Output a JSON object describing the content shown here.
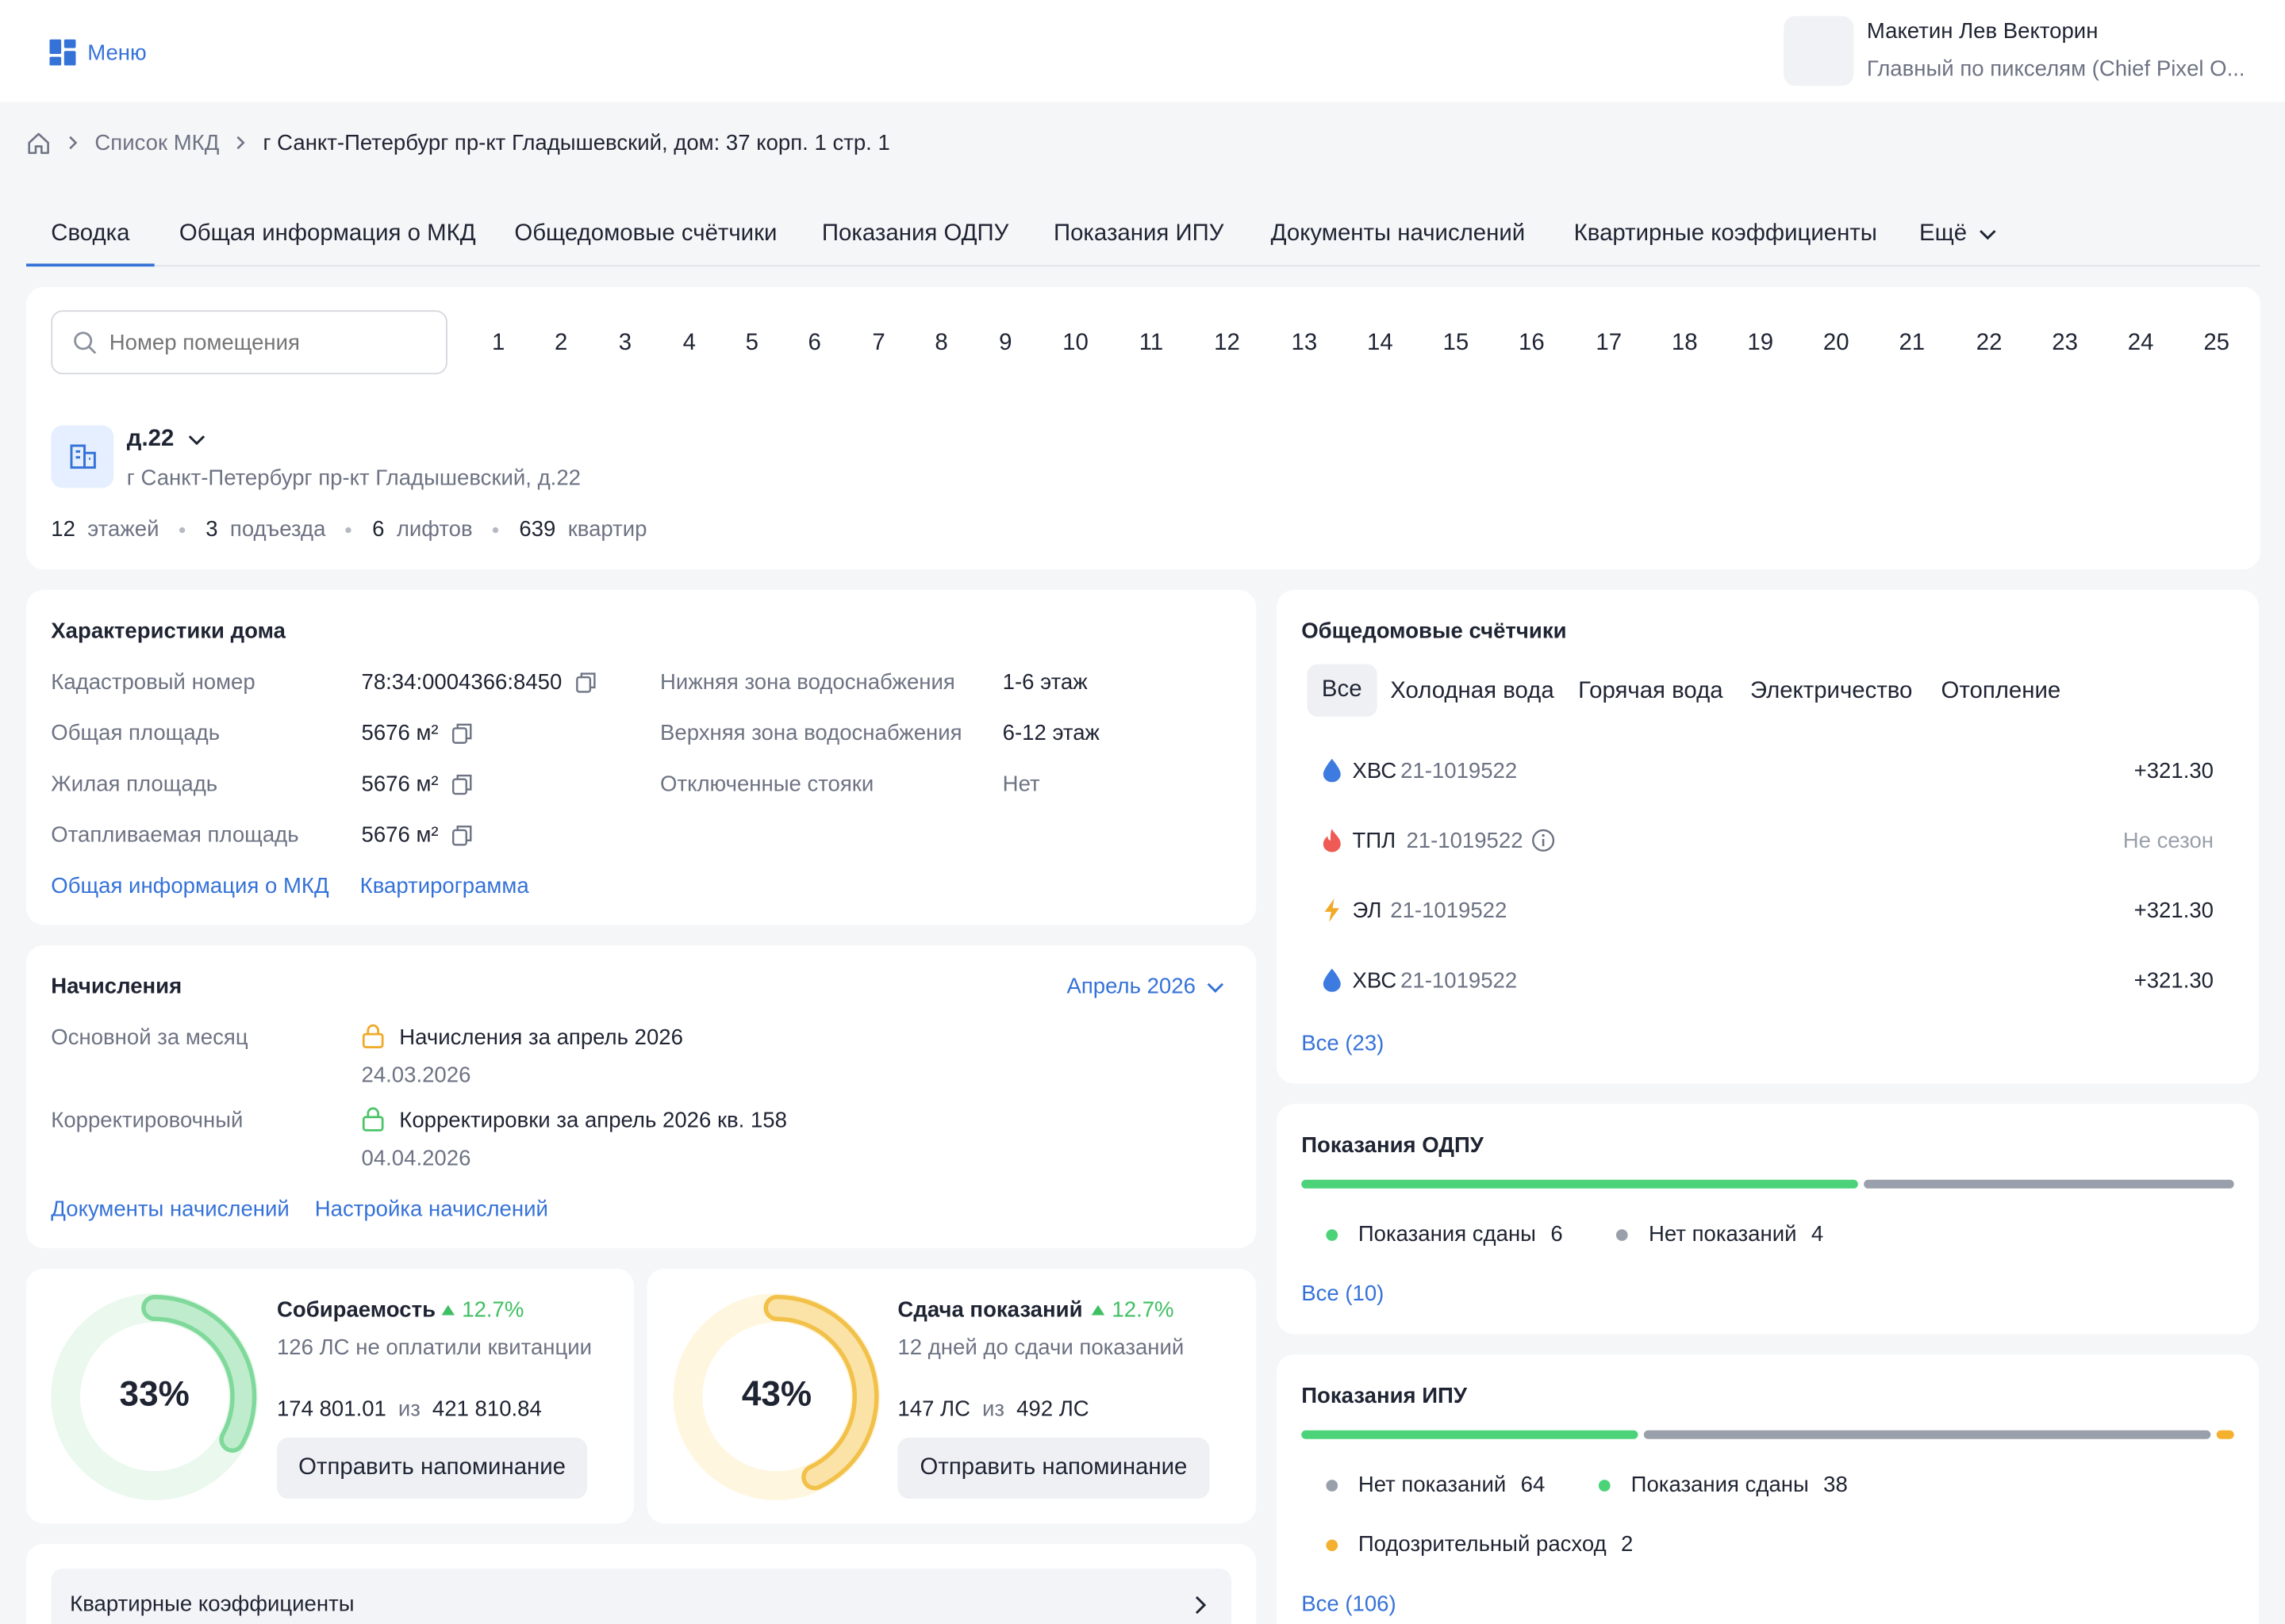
{
  "header": {
    "menu_label": "Меню",
    "user_name": "Макетин Лев Векторин",
    "user_role": "Главный по пикселям (Chief Pixel O..."
  },
  "breadcrumb": {
    "list": "Список МКД",
    "current": "г Санкт-Петербург пр-кт Гладышевский, дом: 37 корп. 1 стр. 1"
  },
  "tabs": [
    {
      "label": "Сводка",
      "active": true
    },
    {
      "label": "Общая информация о МКД"
    },
    {
      "label": "Общедомовые счётчики"
    },
    {
      "label": "Показания ОДПУ"
    },
    {
      "label": "Показания ИПУ"
    },
    {
      "label": "Документы начислений"
    },
    {
      "label": "Квартирные коэффициенты"
    },
    {
      "label": "Ещё"
    }
  ],
  "search": {
    "placeholder": "Номер помещения"
  },
  "pages": [
    "1",
    "2",
    "3",
    "4",
    "5",
    "6",
    "7",
    "8",
    "9",
    "10",
    "11",
    "12",
    "13",
    "14",
    "15",
    "16",
    "17",
    "18",
    "19",
    "20",
    "21",
    "22",
    "23",
    "24",
    "25"
  ],
  "house": {
    "name": "д.22",
    "address": "г Санкт-Петербург пр-кт Гладышевский, д.22",
    "stats": [
      {
        "value": "12",
        "label": "этажей"
      },
      {
        "value": "3",
        "label": "подъезда"
      },
      {
        "value": "6",
        "label": "лифтов"
      },
      {
        "value": "639",
        "label": "квартир"
      }
    ]
  },
  "chars": {
    "title": "Характеристики дома",
    "rows": [
      {
        "label": "Кадастровый номер",
        "value": "78:34:0004366:8450"
      },
      {
        "label": "Общая площадь",
        "value": "5676 м²"
      },
      {
        "label": "Жилая площадь",
        "value": "5676 м²"
      },
      {
        "label": "Отапливаемая площадь",
        "value": "5676 м²"
      }
    ],
    "rows2": [
      {
        "label": "Нижняя зона водоснабжения",
        "value": "1-6 этаж"
      },
      {
        "label": "Верхняя зона водоснабжения",
        "value": "6-12 этаж"
      },
      {
        "label": "Отключенные стояки",
        "value": "Нет"
      }
    ],
    "link1": "Общая информация о МКД",
    "link2": "Квартирограмма"
  },
  "accruals": {
    "title": "Начисления",
    "period": "Апрель 2026",
    "main_label": "Основной за месяц",
    "main_value": "Начисления за апрель 2026",
    "main_date": "24.03.2026",
    "corr_label": "Корректировочный",
    "corr_value": "Корректировки за апрель 2026 кв. 158",
    "corr_date": "04.04.2026",
    "link1": "Документы начислений",
    "link2": "Настройка начислений"
  },
  "collect": {
    "percent": "33%",
    "percent_value": 0.33,
    "title": "Собираемость",
    "trend": "12.7%",
    "subtitle": "126 ЛС не оплатили квитанции",
    "amount": "174 801.01",
    "of": "из",
    "total": "421 810.84",
    "button": "Отправить напоминание"
  },
  "readings": {
    "percent": "43%",
    "percent_value": 0.43,
    "title": "Сдача показаний",
    "trend": "12.7%",
    "subtitle": "12 дней до сдачи показаний",
    "amount": "147 ЛС",
    "of": "из",
    "total": "492 ЛС",
    "button": "Отправить напоминание"
  },
  "coef": {
    "title": "Квартирные коэффициенты"
  },
  "meters": {
    "title": "Общедомовые счётчики",
    "filters": [
      "Все",
      "Холодная вода",
      "Горячая вода",
      "Электричество",
      "Отопление"
    ],
    "items": [
      {
        "icon": "water-drop-icon",
        "type": "ХВС",
        "number": "21-1019522",
        "value": "+321.30",
        "color": "#3d7be0"
      },
      {
        "icon": "fire-icon",
        "type": "ТПЛ",
        "number": "21-1019522",
        "value": "Не сезон",
        "color": "#ef5a55"
      },
      {
        "icon": "lightning-icon",
        "type": "ЭЛ",
        "number": "21-1019522",
        "value": "+321.30",
        "color": "#f1a928"
      },
      {
        "icon": "water-drop-icon",
        "type": "ХВС",
        "number": "21-1019522",
        "value": "+321.30",
        "color": "#3d7be0"
      }
    ],
    "all_link": "Все (23)"
  },
  "odpu": {
    "title": "Показания ОДПУ",
    "items": [
      {
        "label": "Показания сданы",
        "count": "6",
        "color": "#4cd37a"
      },
      {
        "label": "Нет показаний",
        "count": "4",
        "color": "#9aa0ab"
      }
    ],
    "all_link": "Все (10)"
  },
  "ipu": {
    "title": "Показания ИПУ",
    "items": [
      {
        "label": "Нет показаний",
        "count": "64",
        "color": "#9aa0ab"
      },
      {
        "label": "Показания сданы",
        "count": "38",
        "color": "#4cd37a"
      },
      {
        "label": "Подозрительный расход",
        "count": "2",
        "color": "#f4b12f"
      }
    ],
    "all_link": "Все (106)"
  }
}
